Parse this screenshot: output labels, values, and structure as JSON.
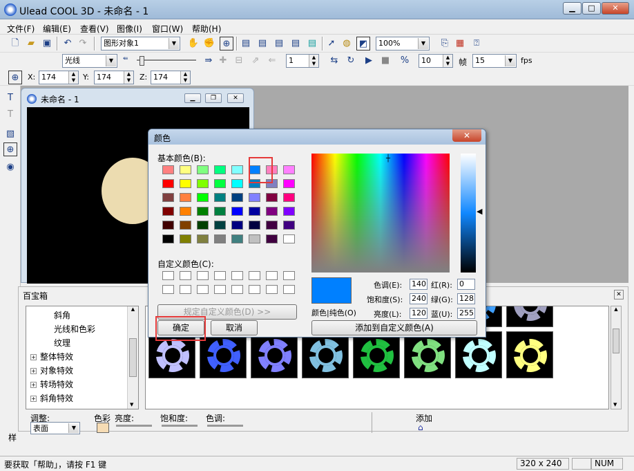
{
  "app": {
    "title": "Ulead COOL 3D - 未命名 - 1"
  },
  "menu": [
    "文件(F)",
    "编辑(E)",
    "查看(V)",
    "图像(I)",
    "窗口(W)",
    "帮助(H)"
  ],
  "toolbar1": {
    "object_select": "图形对象1",
    "zoom": "100%"
  },
  "toolbar2": {
    "effect_select": "光线",
    "frame_value": "1",
    "fps_frames": "10",
    "frame_label": "帧",
    "fps_value": "15",
    "fps_label": "fps"
  },
  "toolbar3": {
    "x_label": "X:",
    "x_value": "174",
    "y_label": "Y:",
    "y_value": "174",
    "z_label": "Z:",
    "z_value": "174"
  },
  "document": {
    "title": "未命名 - 1"
  },
  "color_dialog": {
    "title": "颜色",
    "basic_colors_label": "基本颜色(B):",
    "custom_colors_label": "自定义颜色(C):",
    "define_custom_button": "规定自定义颜色(D) >>",
    "ok_button": "确定",
    "cancel_button": "取消",
    "color_solid_label": "颜色|纯色(O)",
    "add_custom_button": "添加到自定义颜色(A)",
    "hue_label": "色调(E):",
    "hue_value": "140",
    "sat_label": "饱和度(S):",
    "sat_value": "240",
    "lum_label": "亮度(L):",
    "lum_value": "120",
    "red_label": "红(R):",
    "red_value": "0",
    "green_label": "绿(G):",
    "green_value": "128",
    "blue_label": "蓝(U):",
    "blue_value": "255",
    "selected_color": "#0080ff",
    "basic_colors": [
      [
        "#ff8080",
        "#ffff80",
        "#80ff80",
        "#00ff80",
        "#80ffff",
        "#0080ff",
        "#ff80c0",
        "#ff80ff"
      ],
      [
        "#ff0000",
        "#ffff00",
        "#80ff00",
        "#00ff40",
        "#00ffff",
        "#0080c0",
        "#8080c0",
        "#ff00ff"
      ],
      [
        "#804040",
        "#ff8040",
        "#00ff00",
        "#008080",
        "#004080",
        "#8080ff",
        "#800040",
        "#ff0080"
      ],
      [
        "#800000",
        "#ff8000",
        "#008000",
        "#008040",
        "#0000ff",
        "#0000a0",
        "#800080",
        "#8000ff"
      ],
      [
        "#400000",
        "#804000",
        "#004000",
        "#004040",
        "#000080",
        "#000040",
        "#400040",
        "#400080"
      ],
      [
        "#000000",
        "#808000",
        "#808040",
        "#808080",
        "#408080",
        "#c0c0c0",
        "#400040",
        "#ffffff"
      ]
    ]
  },
  "toolbox": {
    "title": "百宝箱",
    "tree": [
      {
        "label": "斜角",
        "indent": true
      },
      {
        "label": "光线和色彩",
        "indent": true
      },
      {
        "label": "纹理",
        "indent": true
      },
      {
        "label": "整体特效",
        "indent": false
      },
      {
        "label": "对象特效",
        "indent": false
      },
      {
        "label": "转场特效",
        "indent": false
      },
      {
        "label": "斜角特效",
        "indent": false
      }
    ],
    "adjust_label": "调整:",
    "adjust_value": "表面",
    "color_label": "色彩",
    "brightness_label": "亮度:",
    "saturation_label": "饱和度:",
    "hue_label": "色调:",
    "add_label": "添加",
    "side_label": "样"
  },
  "gear_colors": [
    "#ffb060",
    "#d8b060",
    "#ff7020",
    "#c04020",
    "#60ff40",
    "#30a020",
    "#40a0ff",
    "#a0a0c0",
    "#c0c0ff",
    "#4060ff",
    "#8080ff",
    "#80c0e0",
    "#20c040",
    "#80e080",
    "#c0ffff",
    "#ffff80"
  ],
  "status": {
    "help_text": "要获取「帮助」，请按 F1 键",
    "size": "320 x 240",
    "num": "NUM"
  }
}
